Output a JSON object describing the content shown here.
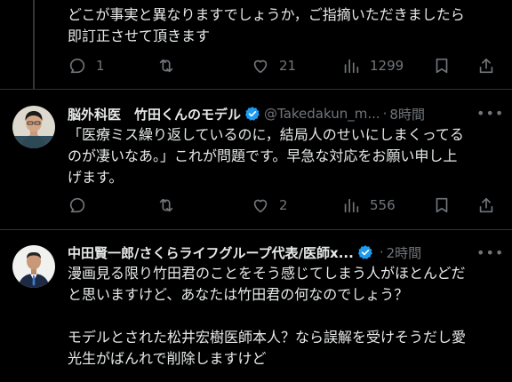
{
  "tweet0": {
    "text_lines": [
      "どこが事実と異なりますでしょうか，ご指摘いただきましたら",
      "即訂正させて頂きます"
    ],
    "replies": "1",
    "retweets": "",
    "likes": "21",
    "views": "1299"
  },
  "tweet1": {
    "name": "脳外科医　竹田くんのモデル",
    "handle": "@Takedakun_m...",
    "time": "8時間",
    "text_lines": [
      "「医療ミス繰り返しているのに，結局人のせいにしまくってる",
      "のが凄いなあ。」これが問題です。早急な対応をお願い申し上",
      "げます。"
    ],
    "replies": "",
    "retweets": "",
    "likes": "2",
    "views": "556"
  },
  "tweet2": {
    "name": "中田賢一郎/さくらライフグループ代表/医師x...",
    "time": "2時間",
    "text_lines": [
      "漫画見る限り竹田君のことをそう感じてしまう人がほとんどだ",
      "と思いますけど、あなたは竹田君の何なのでしょう？",
      "",
      "モデルとされた松井宏樹医師本人？なら誤解を受けそうだし愛",
      "光生がばんれで削除しますけど"
    ]
  },
  "more_label": "•••",
  "separator": "·",
  "colors": {
    "background": "#000000",
    "text": "#e7e9ea",
    "muted": "#71767b",
    "verified": "#1d9bf0"
  }
}
